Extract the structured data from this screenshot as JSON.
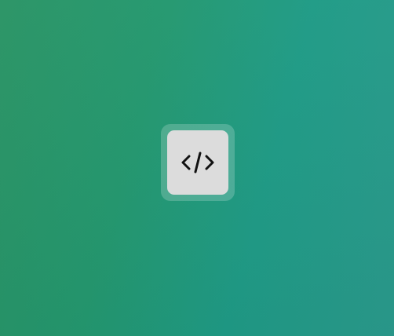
{
  "desktop": {
    "background_start": "#2a9465",
    "background_end": "#2a9a8c"
  },
  "app_icon": {
    "icon": "code-brackets-icon",
    "tile_color": "#dcdcdc",
    "glyph_color": "#111111"
  }
}
